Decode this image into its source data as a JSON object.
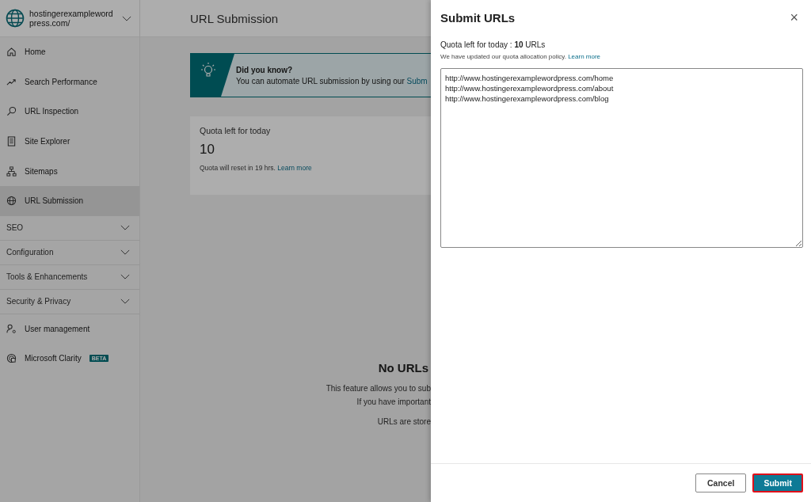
{
  "site": {
    "name": "hostingerexamplewordpress.com/"
  },
  "nav": [
    {
      "kind": "home",
      "label": "Home",
      "selected": false
    },
    {
      "kind": "trend",
      "label": "Search Performance",
      "selected": false
    },
    {
      "kind": "search",
      "label": "URL Inspection",
      "selected": false
    },
    {
      "kind": "doc",
      "label": "Site Explorer",
      "selected": false
    },
    {
      "kind": "sitemap",
      "label": "Sitemaps",
      "selected": false
    },
    {
      "kind": "globe",
      "label": "URL Submission",
      "selected": true
    }
  ],
  "sections": [
    {
      "label": "SEO",
      "expanded": false
    },
    {
      "label": "Configuration",
      "expanded": false
    },
    {
      "label": "Tools & Enhancements",
      "expanded": false
    },
    {
      "label": "Security & Privacy",
      "expanded": false
    }
  ],
  "nav_bottom": [
    {
      "kind": "user",
      "label": "User management",
      "selected": false
    },
    {
      "kind": "clarity",
      "label": "Microsoft Clarity",
      "badge": "BETA",
      "selected": false
    }
  ],
  "page": {
    "title": "URL Submission",
    "tip": {
      "title": "Did you know?",
      "text": "You can automate URL submission by using our ",
      "link": "Subm"
    },
    "quota_card": {
      "title": "Quota left for today",
      "value": "10",
      "note": "Quota will reset in 19 hrs. ",
      "link": "Learn more"
    },
    "empty": {
      "title": "No URLs",
      "lines": [
        "This feature allows you to sub",
        "If you have important",
        "URLs are store"
      ]
    }
  },
  "dialog": {
    "title": "Submit URLs",
    "close": "×",
    "quota": "Quota left for today : **10** URLs",
    "policy": "We have updated our quota allocation policy. ",
    "policy_link": "Learn more",
    "urls": "http://www.hostingerexamplewordpress.com/home\nhttp://www.hostingerexamplewordpress.com/about\nhttp://www.hostingerexamplewordpress.com/blog",
    "buttons": [
      {
        "label": "Cancel",
        "kind": "secondary"
      },
      {
        "label": "Submit",
        "kind": "primary"
      }
    ]
  }
}
